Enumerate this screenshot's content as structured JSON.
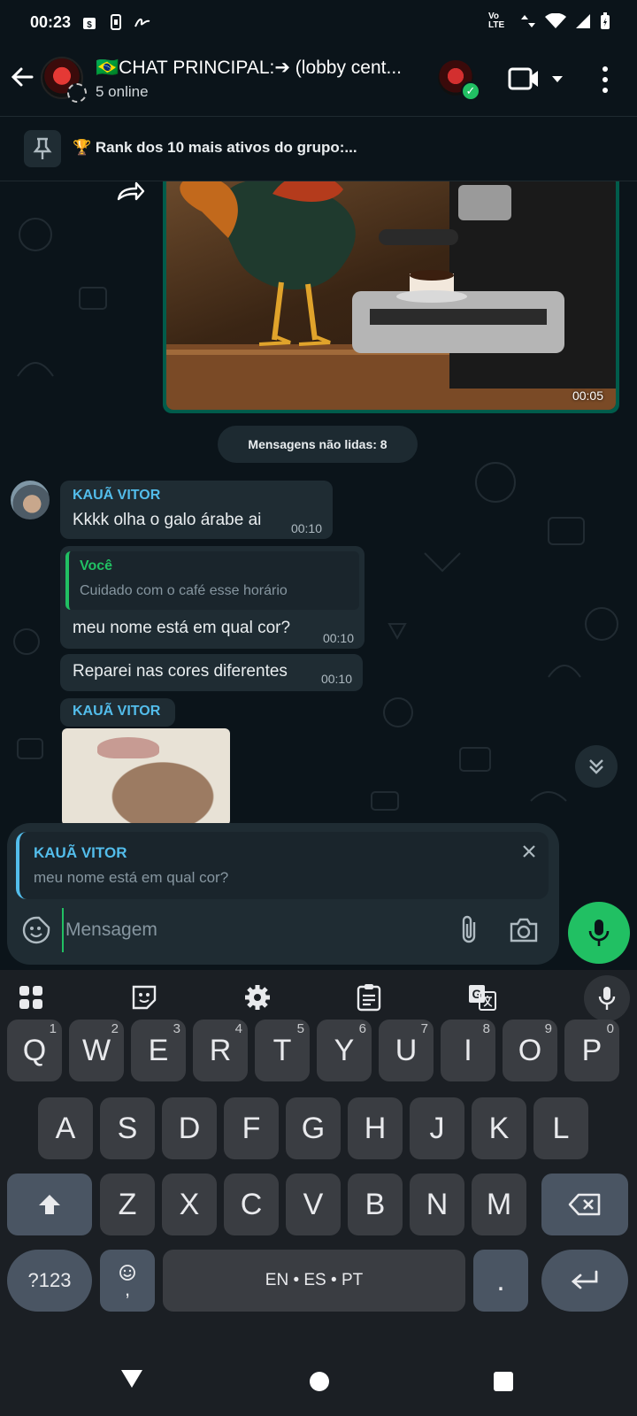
{
  "status_bar": {
    "time": "00:23",
    "network": "Vo LTE"
  },
  "header": {
    "title": "🇧🇷CHAT PRINCIPAL:➔ (lobby cent...",
    "subtitle": "5 online"
  },
  "pinned": {
    "text": "🏆 Rank dos 10 mais ativos do grupo:..."
  },
  "messages": {
    "image_time": "00:05",
    "unread_label": "Mensagens não lidas: 8",
    "m1": {
      "sender": "KAUÃ VITOR",
      "text": "Kkkk olha o galo árabe ai",
      "time": "00:10"
    },
    "m2": {
      "quote_author": "Você",
      "quote_text": "Cuidado com o café esse horário",
      "text": "meu nome está em qual cor?",
      "time": "00:10"
    },
    "m3": {
      "text": "Reparei nas cores diferentes",
      "time": "00:10"
    },
    "m4": {
      "sender": "KAUÃ VITOR"
    }
  },
  "composer": {
    "reply_author": "KAUÃ VITOR",
    "reply_text": "meu nome está em qual cor?",
    "placeholder": "Mensagem"
  },
  "keyboard": {
    "row1": [
      {
        "k": "Q",
        "h": "1"
      },
      {
        "k": "W",
        "h": "2"
      },
      {
        "k": "E",
        "h": "3"
      },
      {
        "k": "R",
        "h": "4"
      },
      {
        "k": "T",
        "h": "5"
      },
      {
        "k": "Y",
        "h": "6"
      },
      {
        "k": "U",
        "h": "7"
      },
      {
        "k": "I",
        "h": "8"
      },
      {
        "k": "O",
        "h": "9"
      },
      {
        "k": "P",
        "h": "0"
      }
    ],
    "row2": [
      "A",
      "S",
      "D",
      "F",
      "G",
      "H",
      "J",
      "K",
      "L"
    ],
    "row3": [
      "Z",
      "X",
      "C",
      "V",
      "B",
      "N",
      "M"
    ],
    "symbols_key": "?123",
    "emoji_key": ",",
    "space_label": "EN • ES • PT",
    "period_key": "."
  },
  "colors": {
    "accent_green": "#21c063",
    "sender_blue": "#53bdeb",
    "bubble": "#1f2c33",
    "background": "#0b141a"
  }
}
